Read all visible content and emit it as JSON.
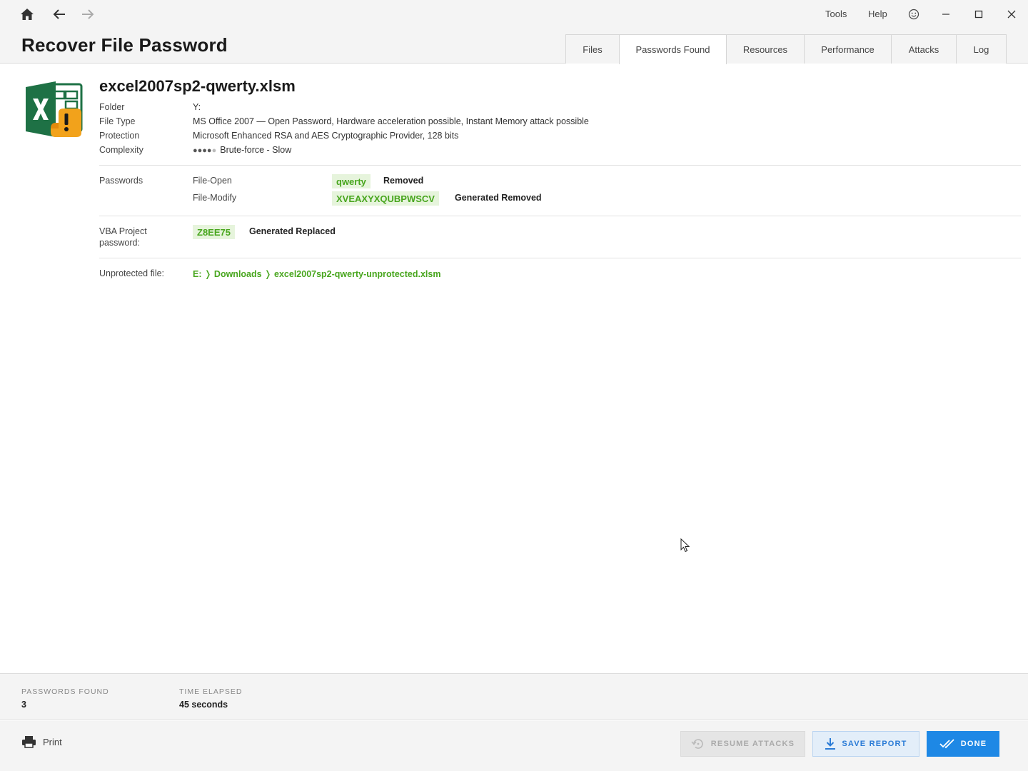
{
  "window": {
    "title": "Recover File Password",
    "menu": {
      "tools": "Tools",
      "help": "Help"
    }
  },
  "tabs": [
    {
      "label": "Files"
    },
    {
      "label": "Passwords Found"
    },
    {
      "label": "Resources"
    },
    {
      "label": "Performance"
    },
    {
      "label": "Attacks"
    },
    {
      "label": "Log"
    }
  ],
  "active_tab": "Passwords Found",
  "file": {
    "name": "excel2007sp2-qwerty.xlsm",
    "folder_label": "Folder",
    "folder": "Y:",
    "type_label": "File Type",
    "type": "MS Office 2007 — Open Password, Hardware acceleration possible, Instant Memory attack possible",
    "protection_label": "Protection",
    "protection": "Microsoft Enhanced RSA and AES Cryptographic Provider, 128 bits",
    "complexity_label": "Complexity",
    "complexity_level": 4,
    "complexity_max": 5,
    "complexity": "Brute-force - Slow"
  },
  "passwords": {
    "label": "Passwords",
    "open_label": "File-Open",
    "open_value": "qwerty",
    "open_status": "Removed",
    "modify_label": "File-Modify",
    "modify_value": "XVEAXYXQUBPWSCV",
    "modify_status": "Generated Removed"
  },
  "vba": {
    "label_line1": "VBA Project",
    "label_line2": "password:",
    "value": "Z8EE75",
    "status": "Generated Replaced"
  },
  "unprotected": {
    "label": "Unprotected file:",
    "path": "E: ❭ Downloads ❭ excel2007sp2-qwerty-unprotected.xlsm"
  },
  "stats": {
    "found_label": "PASSWORDS FOUND",
    "found_value": "3",
    "elapsed_label": "TIME ELAPSED",
    "elapsed_value": "45 seconds"
  },
  "footer": {
    "print": "Print",
    "resume": "RESUME ATTACKS",
    "save": "SAVE REPORT",
    "done": "DONE"
  },
  "colors": {
    "accent_green": "#48a61e",
    "chip_bg": "#e6f4dc",
    "primary_blue": "#1e88e5"
  },
  "icons": {
    "home": "home-icon",
    "back": "arrow-left-icon",
    "forward": "arrow-right-icon",
    "feedback": "smiley-icon",
    "file": "excel-file-warning-icon",
    "print": "printer-icon",
    "resume": "refresh-icon",
    "save": "download-icon",
    "done": "double-check-icon"
  }
}
